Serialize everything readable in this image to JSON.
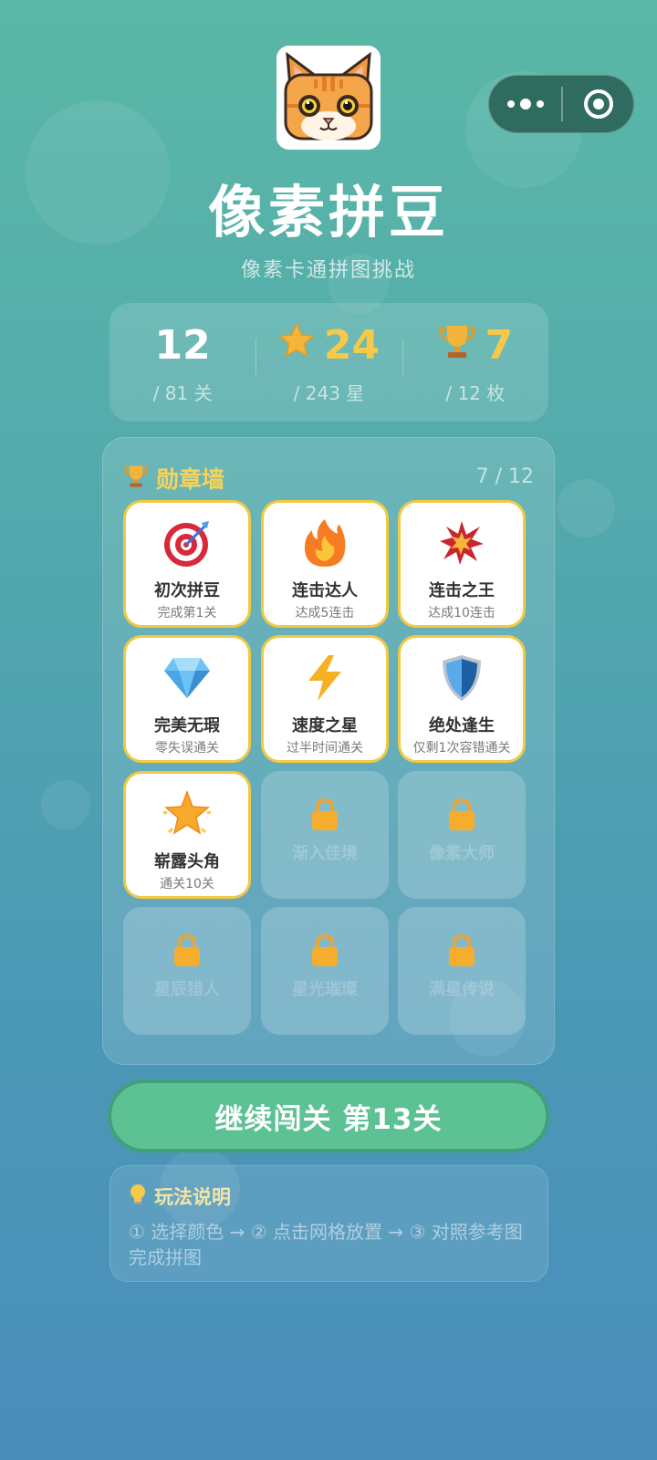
{
  "header": {
    "title": "像素拼豆",
    "subtitle": "像素卡通拼图挑战",
    "logo_icon": "pixel-cat-icon"
  },
  "capsule": {
    "more_icon": "more-dots-icon",
    "close_icon": "target-icon"
  },
  "stats": [
    {
      "value": "12",
      "sub": "/ 81 关",
      "icon": ""
    },
    {
      "value": "24",
      "sub": "/ 243 星",
      "icon": "star-icon"
    },
    {
      "value": "7",
      "sub": "/ 12 枚",
      "icon": "trophy-icon"
    }
  ],
  "badge_wall": {
    "title": "勋章墙",
    "count": "7 / 12",
    "badges": [
      {
        "name": "初次拼豆",
        "desc": "完成第1关",
        "icon": "target-dart-icon",
        "unlocked": true
      },
      {
        "name": "连击达人",
        "desc": "达成5连击",
        "icon": "fire-icon",
        "unlocked": true
      },
      {
        "name": "连击之王",
        "desc": "达成10连击",
        "icon": "explosion-icon",
        "unlocked": true
      },
      {
        "name": "完美无瑕",
        "desc": "零失误通关",
        "icon": "diamond-icon",
        "unlocked": true
      },
      {
        "name": "速度之星",
        "desc": "过半时间通关",
        "icon": "lightning-icon",
        "unlocked": true
      },
      {
        "name": "绝处逢生",
        "desc": "仅剩1次容错通关",
        "icon": "shield-icon",
        "unlocked": true
      },
      {
        "name": "崭露头角",
        "desc": "通关10关",
        "icon": "glowing-star-icon",
        "unlocked": true
      },
      {
        "name": "渐入佳境",
        "desc": "",
        "icon": "lock-icon",
        "unlocked": false
      },
      {
        "name": "像素大师",
        "desc": "",
        "icon": "lock-icon",
        "unlocked": false
      },
      {
        "name": "星辰猎人",
        "desc": "",
        "icon": "lock-icon",
        "unlocked": false
      },
      {
        "name": "星光璀璨",
        "desc": "",
        "icon": "lock-icon",
        "unlocked": false
      },
      {
        "name": "满星传说",
        "desc": "",
        "icon": "lock-icon",
        "unlocked": false
      }
    ]
  },
  "cta": {
    "label": "继续闯关 第13关"
  },
  "help": {
    "title": "玩法说明",
    "icon": "lightbulb-icon",
    "text": "① 选择颜色 → ② 点击网格放置 → ③ 对照参考图完成拼图"
  },
  "colors": {
    "gold": "#f7c948",
    "cta_green": "#5cc294",
    "badge_border": "#f1c943"
  }
}
